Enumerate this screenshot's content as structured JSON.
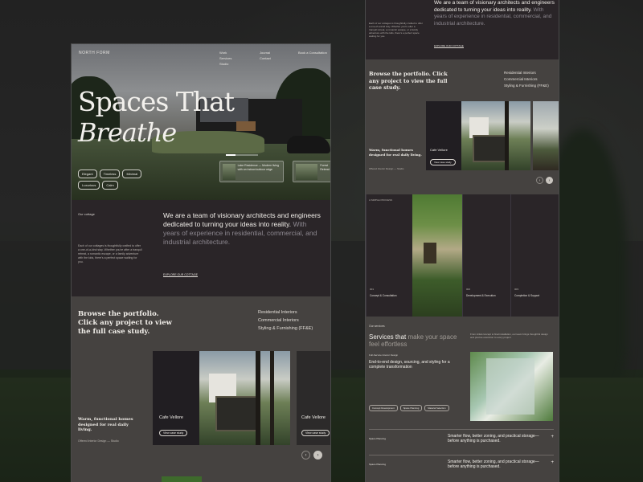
{
  "hero": {
    "brand": "NORTH FORM",
    "nav_col1": [
      "Work",
      "Services",
      "Studio"
    ],
    "nav_col2": [
      "Journal",
      "Contact"
    ],
    "cta": "Book a Consultation",
    "title_line1": "Spaces That",
    "title_line2": "Breathe",
    "tags": [
      "Elegant",
      "Timeless",
      "Minimal",
      "Luxurious",
      "Calm"
    ],
    "mini_card_1": "Lake Residence — Modern living with an indoor/outdoor edge",
    "mini_card_2": "Forest Retreat"
  },
  "about": {
    "label": "Our cottage",
    "lead": "We are a team of visionary architects and engineers dedicated to turning your ideas into reality.",
    "lead_muted": "With years of experience in residential, commercial, and industrial architecture.",
    "small": "Each of our cottages is thoughtfully crafted to offer a one-of-a-kind stay. Whether you're after a tranquil retreat, a romantic escape, or a family adventure with the kids, there's a perfect space waiting for you.",
    "link": "EXPLORE OUR COTTAGE"
  },
  "portfolio": {
    "title": "Browse the portfolio. Click any project to view the full case study.",
    "categories": [
      "Residential Interiors",
      "Commercial Interiors",
      "Styling & Furnishing (FF&E)"
    ],
    "quote": "Warm, functional homes designed for real daily living.",
    "quote_meta": "Offered Interior Design — Studio",
    "project_name": "Cafe Vellore",
    "project_btn": "View case study",
    "project2_name": "Cafe Vellore",
    "project2_btn": "View case study",
    "prev": "‹",
    "next": "›"
  },
  "process": {
    "label": "A SIMPLE PROCESS",
    "steps": [
      {
        "num": "001",
        "name": "Concept & Consultation"
      },
      {
        "num": "002",
        "name": "Development & Execution"
      },
      {
        "num": "003",
        "name": "Completion & Support"
      }
    ]
  },
  "services": {
    "label": "Our services",
    "small": "From initial concept to final installation, our team brings thoughtful design and precise execution to every project.",
    "title_a": "Services that",
    "title_b": "make your space feel effortless",
    "item": "Full-Service Interior Design",
    "head": "End-to-end design, sourcing, and styling for a complete transformation",
    "tags": [
      "Concept Development",
      "Space Planning",
      "Material Selection"
    ],
    "accordion": [
      {
        "name": "Space Planning",
        "desc": "Smarter flow, better zoning, and practical storage—before anything is purchased."
      },
      {
        "name": "Space Planning",
        "desc": "Smarter flow, better zoning, and practical storage—before anything is purchased."
      }
    ],
    "plus": "+"
  }
}
